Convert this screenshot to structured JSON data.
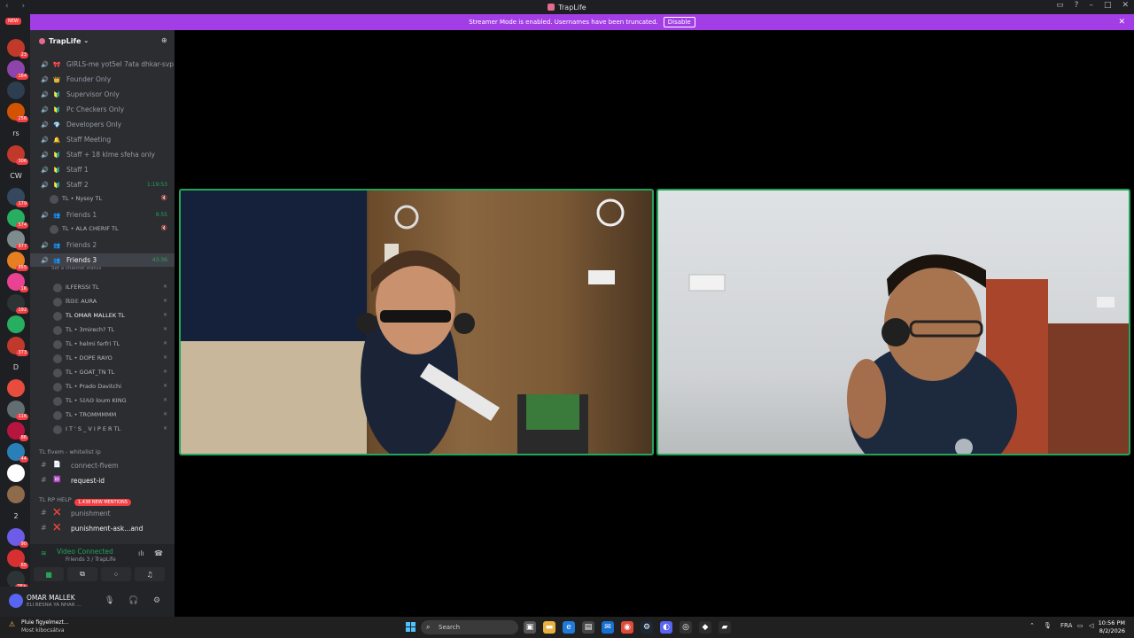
{
  "window": {
    "title": "TrapLife"
  },
  "banner": {
    "text": "Streamer Mode is enabled. Usernames have been truncated.",
    "disable_label": "Disable"
  },
  "rail": {
    "new_label": "NEW",
    "items": [
      {
        "label": "",
        "badge": "23"
      },
      {
        "label": "",
        "badge": "164"
      },
      {
        "label": "",
        "badge": ""
      },
      {
        "label": "",
        "badge": "256"
      },
      {
        "label": "rs",
        "badge": ""
      },
      {
        "label": "",
        "badge": "306"
      },
      {
        "label": "CW",
        "badge": ""
      },
      {
        "label": "",
        "badge": "179"
      },
      {
        "label": "",
        "badge": "574"
      },
      {
        "label": "",
        "badge": "977"
      },
      {
        "label": "",
        "badge": "855"
      },
      {
        "label": "",
        "badge": "1K"
      },
      {
        "label": "",
        "badge": "192"
      },
      {
        "label": "",
        "badge": ""
      },
      {
        "label": "",
        "badge": "373"
      },
      {
        "label": "D",
        "badge": ""
      },
      {
        "label": "",
        "badge": ""
      },
      {
        "label": "",
        "badge": "116"
      },
      {
        "label": "",
        "badge": "86"
      },
      {
        "label": "",
        "badge": "44"
      },
      {
        "label": "",
        "badge": ""
      },
      {
        "label": "",
        "badge": ""
      },
      {
        "label": "2",
        "badge": ""
      },
      {
        "label": "",
        "badge": "90"
      },
      {
        "label": "",
        "badge": "65"
      },
      {
        "label": "",
        "badge": "2K+"
      }
    ]
  },
  "server": {
    "name": "TrapLife"
  },
  "channels": [
    {
      "emoji": "🎀",
      "name": "GIRLS-me yot5el 7ata dhkar-svp",
      "time": "",
      "active": false
    },
    {
      "emoji": "👑",
      "name": "Founder Only",
      "time": "",
      "active": false
    },
    {
      "emoji": "🔰",
      "name": "Supervisor Only",
      "time": "",
      "active": false
    },
    {
      "emoji": "🔰",
      "name": "Pc Checkers Only",
      "time": "",
      "active": false
    },
    {
      "emoji": "💎",
      "name": "Developers Only",
      "time": "",
      "active": false
    },
    {
      "emoji": "🔔",
      "name": "Staff Meeting",
      "time": "",
      "active": false
    },
    {
      "emoji": "🔰",
      "name": "Staff + 18 klme sfeha only",
      "time": "",
      "active": false
    },
    {
      "emoji": "🔰",
      "name": "Staff 1",
      "time": "",
      "active": false
    },
    {
      "emoji": "🔰",
      "name": "Staff 2",
      "time": "1:19:53",
      "active": false
    },
    {
      "emoji": "",
      "name": "TL • Nysoy  TL",
      "time": "",
      "active": false,
      "member": true
    },
    {
      "emoji": "👥",
      "name": "Friends 1",
      "time": "9:55",
      "active": false
    },
    {
      "emoji": "",
      "name": "TL • ALA CHERIF  TL",
      "time": "",
      "active": false,
      "member": true
    },
    {
      "emoji": "👥",
      "name": "Friends 2",
      "time": "",
      "active": false
    },
    {
      "emoji": "👥",
      "name": "Friends 3",
      "time": "43:36",
      "active": true
    }
  ],
  "friends3_status": "Set a channel status",
  "members": [
    "ILFERSSI  TL",
    "ℝ𝔻𝔼  AURA",
    "TL  OMAR MALLEK  TL",
    "TL • 3mirech?  TL",
    "TL • helmi ferfri  TL",
    "TL • DOPE RAYO",
    "TL • GOAT_TN  TL",
    "TL • Prado Davitchi",
    "TL • 𝕊𝕀𝔸𝕆 loum  KING",
    "TL • TROMMMMM",
    "I T ' S _ V I P E R  TL"
  ],
  "text_categories": [
    {
      "name": "TL fivem - whitelist ip"
    },
    {
      "name": "TL RP HELP"
    }
  ],
  "text_channels": [
    {
      "emoji": "📄",
      "name": "connect-fivem"
    },
    {
      "emoji": "🆔",
      "name": "request-id"
    },
    {
      "emoji": "❌",
      "name": "punishment"
    },
    {
      "emoji": "❌",
      "name": "punishment-ask...and"
    }
  ],
  "mentions": "1,438 NEW MENTIONS",
  "voice": {
    "status": "Video Connected",
    "location": "Friends 3 / TrapLife"
  },
  "user": {
    "name": "OMAR MALLEK",
    "status": "ELI BESNA YA NHAR ..."
  },
  "taskbar": {
    "weather_title": "Pluie figyelmezt...",
    "weather_sub": "Most kibocsátva",
    "search_placeholder": "Search",
    "lang": "FRA",
    "time": "10:56 PM",
    "date": "8/2/2026"
  },
  "colors": {
    "accent": "#a33ee6",
    "speaking": "#23a55a",
    "danger": "#f23f43"
  }
}
